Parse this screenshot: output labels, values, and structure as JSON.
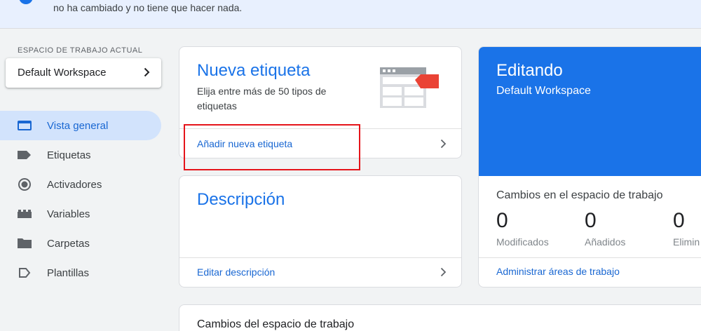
{
  "banner": {
    "text": "no ha cambiado y no tiene que hacer nada."
  },
  "sidebar": {
    "workspace_label": "ESPACIO DE TRABAJO ACTUAL",
    "workspace_name": "Default Workspace",
    "items": [
      {
        "label": "Vista general",
        "icon": "overview-icon",
        "active": true
      },
      {
        "label": "Etiquetas",
        "icon": "tag-icon"
      },
      {
        "label": "Activadores",
        "icon": "trigger-icon"
      },
      {
        "label": "Variables",
        "icon": "variables-icon"
      },
      {
        "label": "Carpetas",
        "icon": "folder-icon"
      },
      {
        "label": "Plantillas",
        "icon": "template-icon"
      }
    ]
  },
  "new_tag_card": {
    "title": "Nueva etiqueta",
    "subtitle": "Elija entre más de 50 tipos de etiquetas",
    "link": "Añadir nueva etiqueta"
  },
  "description_card": {
    "title": "Descripción",
    "link": "Editar descripción"
  },
  "editing_card": {
    "title": "Editando",
    "workspace": "Default Workspace",
    "changes_label": "Cambios en el espacio de trabajo",
    "stats": [
      {
        "value": "0",
        "label": "Modificados"
      },
      {
        "value": "0",
        "label": "Añadidos"
      },
      {
        "value": "0",
        "label": "Elimin"
      }
    ],
    "link": "Administrar áreas de trabajo"
  },
  "changes_card": {
    "title": "Cambios del espacio de trabajo"
  },
  "colors": {
    "accent": "#1a73e8",
    "nav_active_bg": "#d2e3fc",
    "highlight": "#e5141a"
  }
}
